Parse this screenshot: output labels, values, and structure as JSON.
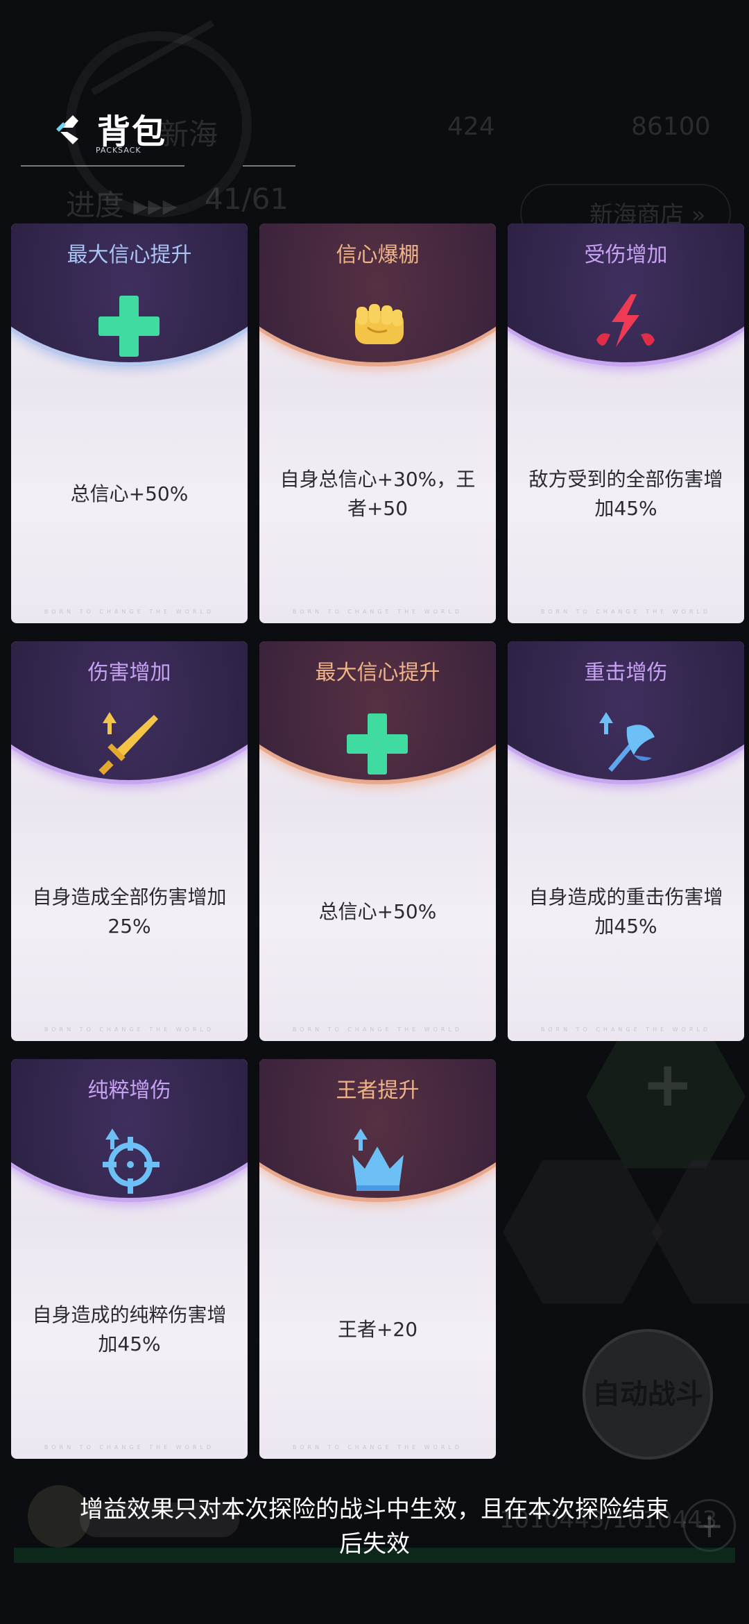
{
  "header": {
    "title": "背包",
    "subtitle": "PACKSACK"
  },
  "background": {
    "stage_name": "新海",
    "progress_label": "进度 ▸▸▸",
    "progress_value": "41/61",
    "currency1": "424",
    "currency2": "86100",
    "shop_label": "新海商店 »",
    "auto_battle": "自动战斗",
    "bottom_counter": "1010443/1010443"
  },
  "cards": [
    {
      "title": "最大信心提升",
      "desc": "总信心+50%",
      "theme": "blue",
      "icon": "green-plus-icon"
    },
    {
      "title": "信心爆棚",
      "desc": "自身总信心+30%，王者+50",
      "theme": "orange",
      "icon": "fist-icon"
    },
    {
      "title": "受伤增加",
      "desc": "敌方受到的全部伤害增加45%",
      "theme": "purple",
      "icon": "lightning-damage-icon"
    },
    {
      "title": "伤害增加",
      "desc": "自身造成全部伤害增加25%",
      "theme": "purple",
      "icon": "sword-up-icon"
    },
    {
      "title": "最大信心提升",
      "desc": "总信心+50%",
      "theme": "orange",
      "icon": "green-plus-icon"
    },
    {
      "title": "重击增伤",
      "desc": "自身造成的重击伤害增加45%",
      "theme": "purple",
      "icon": "axe-up-icon"
    },
    {
      "title": "纯粹增伤",
      "desc": "自身造成的纯粹伤害增加45%",
      "theme": "purple",
      "icon": "crosshair-up-icon"
    },
    {
      "title": "王者提升",
      "desc": "王者+20",
      "theme": "orange",
      "icon": "crown-up-icon"
    }
  ],
  "card_footer": "BORN TO CHANGE THE WORLD",
  "notice": "增益效果只对本次探险的战斗中生效，且在本次探险结束后失效"
}
